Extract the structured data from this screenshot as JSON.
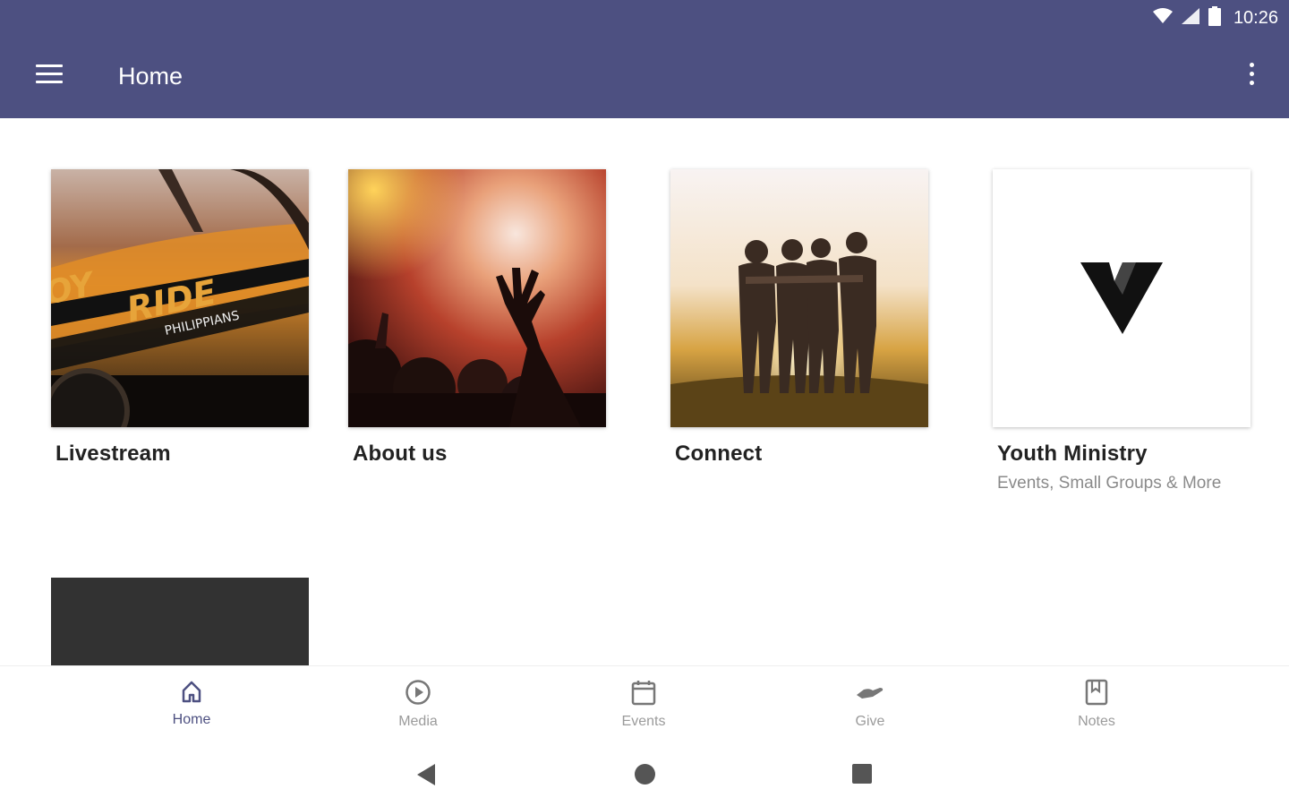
{
  "status_bar": {
    "time": "10:26",
    "icons": [
      "wifi-icon",
      "signal-icon",
      "battery-icon"
    ]
  },
  "app_bar": {
    "title": "Home",
    "color": "#4d5081",
    "menu_icon": "menu-icon",
    "overflow_icon": "more-vert-icon"
  },
  "cards": [
    {
      "title": "Livestream",
      "subtitle": "",
      "image": "car-livestream-image"
    },
    {
      "title": "About us",
      "subtitle": "",
      "image": "worship-concert-image"
    },
    {
      "title": "Connect",
      "subtitle": "",
      "image": "friends-sunset-image"
    },
    {
      "title": "Youth Ministry",
      "subtitle": "Events, Small Groups & More",
      "image": "v-logo-image"
    }
  ],
  "image_text": {
    "car_text_1": "OY",
    "car_text_2": "RIDE",
    "car_text_3": "PHILIPPIANS"
  },
  "bottom_nav": {
    "active": "Home",
    "items": [
      {
        "label": "Home",
        "icon": "home-icon"
      },
      {
        "label": "Media",
        "icon": "play-circle-icon"
      },
      {
        "label": "Events",
        "icon": "calendar-icon"
      },
      {
        "label": "Give",
        "icon": "give-hand-icon"
      },
      {
        "label": "Notes",
        "icon": "notes-icon"
      }
    ]
  },
  "system_nav": {
    "icons": [
      "back-icon",
      "home-circle-icon",
      "recents-icon"
    ]
  }
}
